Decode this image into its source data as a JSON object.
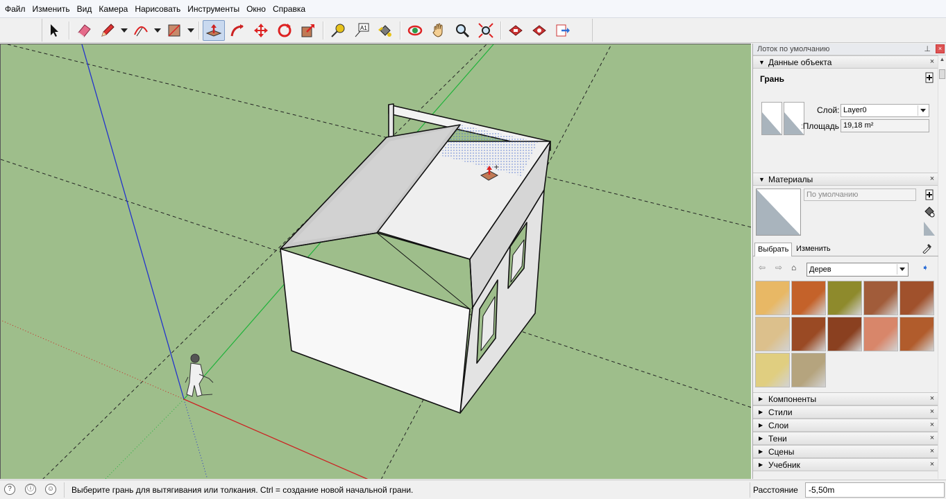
{
  "menu": [
    "Файл",
    "Изменить",
    "Вид",
    "Камера",
    "Нарисовать",
    "Инструменты",
    "Окно",
    "Справка"
  ],
  "toolbar": {
    "tools": [
      "select-tool",
      "eraser-tool",
      "pencil-tool",
      "arc-tool",
      "shapes-tool",
      "push-pull-tool",
      "follow-me-tool",
      "move-tool",
      "rotate-tool",
      "scale-tool",
      "tape-measure-tool",
      "text-tool",
      "paint-bucket-tool",
      "orbit-tool",
      "pan-tool",
      "zoom-tool",
      "zoom-extents-tool",
      "warehouse-tool",
      "extension-warehouse-tool",
      "send-to-layout-tool"
    ],
    "active_tool": "push-pull-tool",
    "text_tool_glyph": "A1"
  },
  "tray": {
    "title": "Лоток по умолчанию",
    "entity_info": {
      "heading": "Данные объекта",
      "entity_name": "Грань",
      "layer_label": "Слой:",
      "layer_value": "Layer0",
      "area_label": "Площадь:",
      "area_value": "19,18 m²"
    },
    "materials": {
      "heading": "Материалы",
      "material_name": "По умолчанию",
      "tab_select": "Выбрать",
      "tab_edit": "Изменить",
      "collection": "Дерев",
      "swatch_colors": [
        "#e8b865",
        "#c4622a",
        "#8e8a2c",
        "#a15c3a",
        "#a0512c",
        "#dcc08c",
        "#9a4a24",
        "#8a4020",
        "#d8866a",
        "#b15c2c",
        "#e0ce80",
        "#b5a47e"
      ]
    },
    "collapsed_panels": [
      "Компоненты",
      "Стили",
      "Слои",
      "Тени",
      "Сцены",
      "Учебник"
    ]
  },
  "status": {
    "message": "Выберите грань для вытягивания или толкания.  Ctrl = создание новой начальной грани.",
    "measurement_label": "Расстояние",
    "measurement_value": "-5,50m"
  }
}
